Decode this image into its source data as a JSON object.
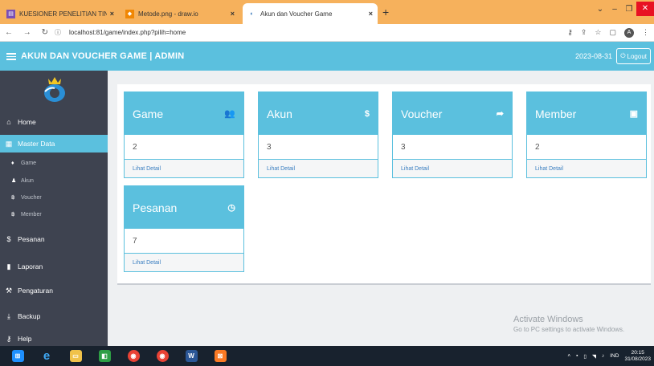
{
  "browser": {
    "tabs": [
      {
        "title": "KUESIONER PENELITIAN TINGKA",
        "close": "×"
      },
      {
        "title": "Metode.png - draw.io",
        "close": "×"
      },
      {
        "title": "Akun dan Voucher Game",
        "close": "×"
      }
    ],
    "new_tab": "+",
    "url": "localhost:81/game/index.php?pilih=home"
  },
  "header": {
    "title": "AKUN DAN VOUCHER GAME | ADMIN",
    "date": "2023-08-31",
    "logout": "Logout"
  },
  "sidebar": {
    "items": [
      {
        "label": "Home"
      },
      {
        "label": "Master Data"
      },
      {
        "label": "Pesanan"
      },
      {
        "label": "Laporan"
      },
      {
        "label": "Pengaturan"
      },
      {
        "label": "Backup"
      },
      {
        "label": "Help"
      }
    ],
    "sub_items": [
      {
        "label": "Game"
      },
      {
        "label": "Akun"
      },
      {
        "label": "Voucher"
      },
      {
        "label": "Member"
      }
    ]
  },
  "cards": [
    {
      "name": "Game",
      "value": "2",
      "link": "Lihat Detail",
      "icon": "users-icon"
    },
    {
      "name": "Akun",
      "value": "3",
      "link": "Lihat Detail",
      "icon": "dollar-icon"
    },
    {
      "name": "Voucher",
      "value": "3",
      "link": "Lihat Detail",
      "icon": "share-icon"
    },
    {
      "name": "Member",
      "value": "2",
      "link": "Lihat Detail",
      "icon": "save-icon"
    },
    {
      "name": "Pesanan",
      "value": "7",
      "link": "Lihat Detail",
      "icon": "clock-icon"
    }
  ],
  "watermark": {
    "line1": "Activate Windows",
    "line2": "Go to PC settings to activate Windows."
  },
  "taskbar": {
    "lang": "IND",
    "time": "20:15",
    "date": "31/08/2023"
  },
  "colors": {
    "accent": "#5bc0de",
    "sidebar": "#3e4350",
    "tabbar": "#f6b15c"
  }
}
